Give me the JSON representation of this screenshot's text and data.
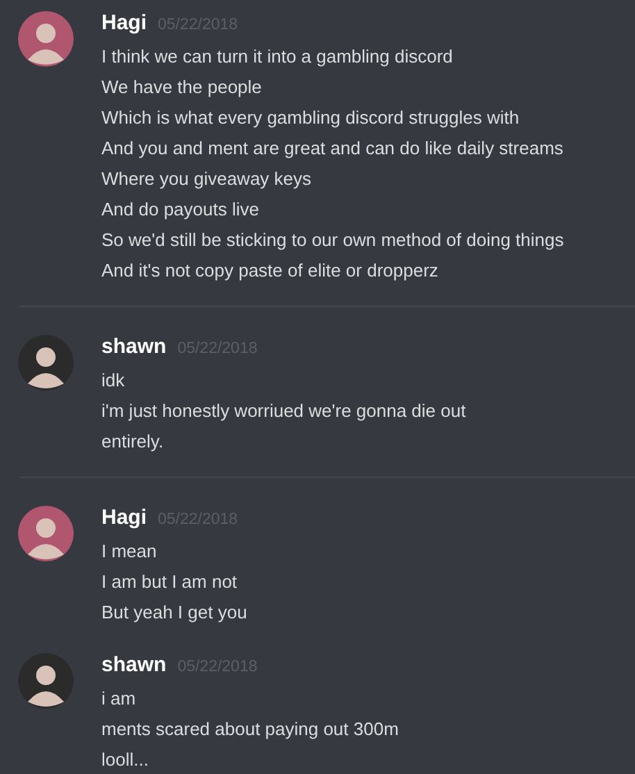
{
  "messages": [
    {
      "author": "Hagi",
      "timestamp": "05/22/2018",
      "color": "#b0566f",
      "divider_above": false,
      "lines": [
        "I think we can turn it into a gambling discord",
        "We have the people",
        "Which is what every gambling discord struggles with",
        "And you and ment are great and can do like daily streams",
        "Where you giveaway keys",
        "And do payouts live",
        "So we'd still be sticking to our own method of doing things",
        "And it's not copy paste of elite or dropperz"
      ]
    },
    {
      "author": "shawn",
      "timestamp": "05/22/2018",
      "color": "#2b2b2b",
      "divider_above": true,
      "lines": [
        "idk",
        "i'm just honestly worriued we're gonna die out",
        "entirely."
      ]
    },
    {
      "author": "Hagi",
      "timestamp": "05/22/2018",
      "color": "#b0566f",
      "divider_above": true,
      "lines": [
        "I mean",
        "I am but I am not",
        "But yeah I get you"
      ]
    },
    {
      "author": "shawn",
      "timestamp": "05/22/2018",
      "color": "#2b2b2b",
      "divider_above": false,
      "lines": [
        "i am",
        "ments scared about paying out 300m",
        "looll..."
      ]
    }
  ]
}
